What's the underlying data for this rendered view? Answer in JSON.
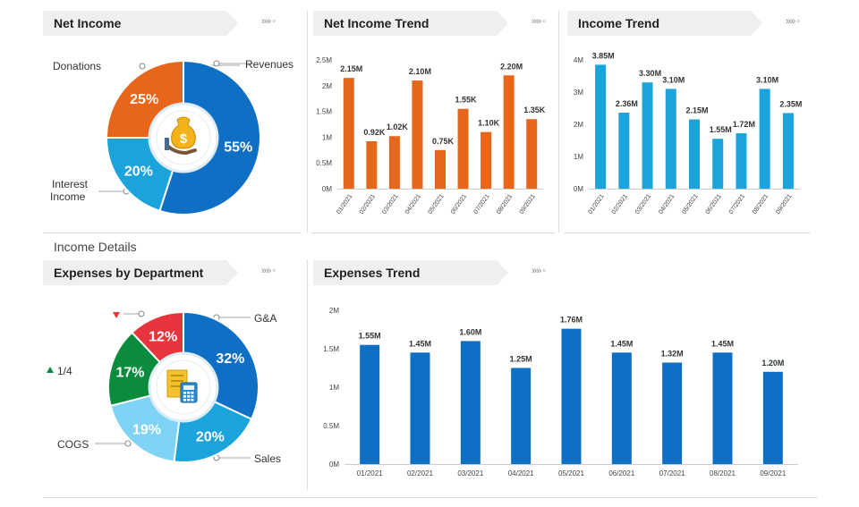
{
  "panels": {
    "net_income": {
      "title": "Net Income"
    },
    "net_income_trend": {
      "title": "Net Income Trend"
    },
    "income_trend": {
      "title": "Income Trend"
    },
    "expenses_by_department": {
      "title": "Expenses by Department"
    },
    "expenses_trend": {
      "title": "Expenses Trend"
    }
  },
  "more_glyph": "»» ◦",
  "section_label": "Income Details",
  "pie_labels": {
    "donations": "Donations",
    "revenues": "Revenues",
    "interest_income_line1": "Interest",
    "interest_income_line2": "Income",
    "ga": "G&A",
    "ratio": "1/4",
    "cogs": "COGS",
    "sales": "Sales"
  },
  "icons": {
    "net_income_center": "money-bag-icon",
    "expenses_center": "document-calculator-icon",
    "up_arrow": "triangle-up-icon",
    "down_arrow": "triangle-down-icon"
  },
  "colors": {
    "orange": "#e8661a",
    "blue": "#0e6fc4",
    "cyan": "#1ba3dc",
    "light_blue": "#7fd3f5",
    "red": "#e8343c",
    "green": "#0a8b3e"
  },
  "chart_data": [
    {
      "id": "net_income_pie",
      "type": "pie",
      "labels": [
        "Revenues",
        "Interest Income",
        "Donations"
      ],
      "values": [
        55,
        20,
        25
      ],
      "display": [
        "55%",
        "20%",
        "25%"
      ],
      "colors": [
        "#0e6fc4",
        "#1ba3dc",
        "#e8661a"
      ]
    },
    {
      "id": "net_income_trend",
      "type": "bar",
      "categories": [
        "01/2021",
        "02/2021",
        "03/2021",
        "04/2021",
        "05/2021",
        "06/2021",
        "07/2021",
        "08/2021",
        "09/2021"
      ],
      "values": [
        2.15,
        0.92,
        1.02,
        2.1,
        0.75,
        1.55,
        1.1,
        2.2,
        1.35
      ],
      "data_labels": [
        "2.15M",
        "0.92K",
        "1.02K",
        "2.10M",
        "0.75K",
        "1.55K",
        "1.10K",
        "2.20M",
        "1.35K"
      ],
      "yticks": [
        "0M",
        "0.5M",
        "1M",
        "1.5M",
        "2M",
        "2.5M"
      ],
      "ylim": [
        0,
        2.5
      ],
      "color": "#e8661a"
    },
    {
      "id": "income_trend",
      "type": "bar",
      "categories": [
        "01/2021",
        "02/2021",
        "03/2021",
        "04/2021",
        "05/2021",
        "06/2021",
        "07/2021",
        "08/2021",
        "09/2021"
      ],
      "values": [
        3.85,
        2.36,
        3.3,
        3.1,
        2.15,
        1.55,
        1.72,
        3.1,
        2.35
      ],
      "data_labels": [
        "3.85M",
        "2.36M",
        "3.30M",
        "3.10M",
        "2.15M",
        "1.55M",
        "1.72M",
        "3.10M",
        "2.35M"
      ],
      "yticks": [
        "0M",
        "1M",
        "2M",
        "3M",
        "4M"
      ],
      "ylim": [
        0,
        4
      ],
      "color": "#1ba3dc"
    },
    {
      "id": "expenses_by_department_pie",
      "type": "pie",
      "labels": [
        "G&A",
        "Sales",
        "",
        "",
        ""
      ],
      "values": [
        32,
        20,
        19,
        17,
        12
      ],
      "display": [
        "32%",
        "20%",
        "19%",
        "17%",
        "12%"
      ],
      "colors": [
        "#0e6fc4",
        "#1ba3dc",
        "#7fd3f5",
        "#0a8b3e",
        "#e8343c"
      ]
    },
    {
      "id": "expenses_trend",
      "type": "bar",
      "categories": [
        "01/2021",
        "02/2021",
        "03/2021",
        "04/2021",
        "05/2021",
        "06/2021",
        "07/2021",
        "08/2021",
        "09/2021"
      ],
      "values": [
        1.55,
        1.45,
        1.6,
        1.25,
        1.76,
        1.45,
        1.32,
        1.45,
        1.2
      ],
      "data_labels": [
        "1.55M",
        "1.45M",
        "1.60M",
        "1.25M",
        "1.76M",
        "1.45M",
        "1.32M",
        "1.45M",
        "1.20M"
      ],
      "yticks": [
        "0M",
        "0.5M",
        "1M",
        "1.5M",
        "2M"
      ],
      "ylim": [
        0,
        2
      ],
      "color": "#0e6fc4"
    }
  ]
}
